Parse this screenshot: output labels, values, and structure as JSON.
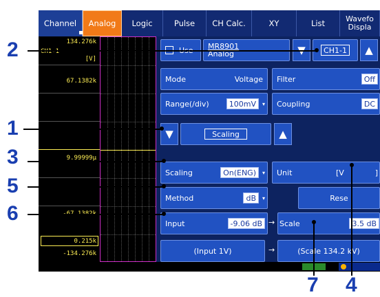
{
  "tabs": [
    {
      "label": "Channel"
    },
    {
      "label": "Analog"
    },
    {
      "label": "Logic"
    },
    {
      "label": "Pulse"
    },
    {
      "label": "CH Calc."
    },
    {
      "label": "XY"
    },
    {
      "label": "List"
    },
    {
      "label": "Waveform Display",
      "line1": "Wavefo",
      "line2": "Displa"
    }
  ],
  "waveform": {
    "channel": "CH1-1",
    "unit": "[V]",
    "y_values": [
      "134.276k",
      "67.1382k",
      "9.99999µ",
      "-67.1382k",
      "0.215k",
      "-134.276k"
    ]
  },
  "module": {
    "use_label": "Use",
    "model": "MR8901",
    "type": "Analog",
    "channel": "CH1-1"
  },
  "settings": {
    "mode_label": "Mode",
    "mode_value": "Voltage",
    "filter_label": "Filter",
    "filter_value": "Off",
    "range_label": "Range(/div)",
    "range_value": "100mV",
    "coupling_label": "Coupling",
    "coupling_value": "DC",
    "scaling_section": "Scaling",
    "scaling_label": "Scaling",
    "scaling_value": "On(ENG)",
    "unit_label": "Unit",
    "unit_value": "[V",
    "unit_close": "]",
    "method_label": "Method",
    "method_value": "dB",
    "reset_label": "Rese",
    "input_label": "Input",
    "input_value": "-9.06 dB",
    "arrow": "→",
    "scale_label": "Scale",
    "scale_value": "3.5 dB",
    "input_1v": "(Input 1V)",
    "scale_result": "(Scale 134.2 kV)"
  },
  "callouts": [
    "2",
    "1",
    "3",
    "5",
    "6",
    "7",
    "4"
  ]
}
